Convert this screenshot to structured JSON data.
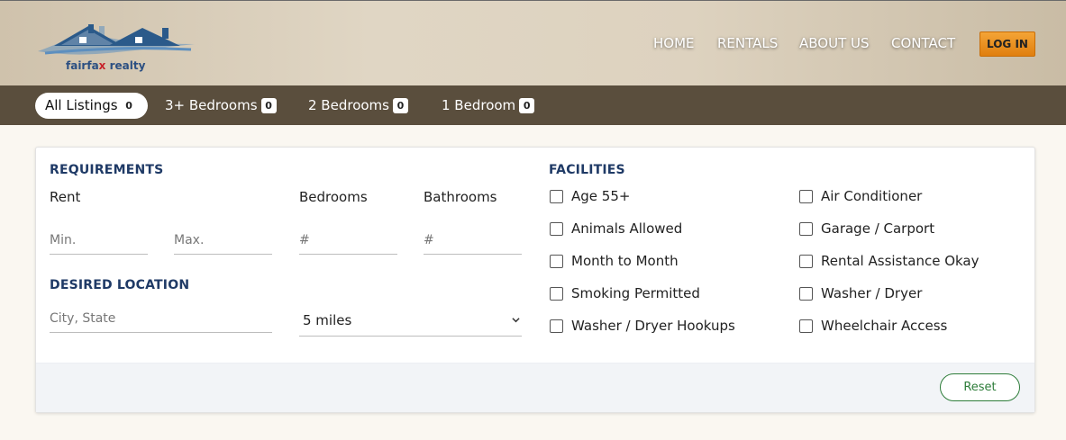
{
  "brand": {
    "name_part1": "fairfa",
    "name_x": "x",
    "name_part2": " realty",
    "colors": {
      "roof_blue": "#2b5a8a",
      "roof_light": "#5d8fbf",
      "accent_red": "#c8242b"
    }
  },
  "nav": {
    "items": [
      {
        "label": "HOME"
      },
      {
        "label": "RENTALS"
      },
      {
        "label": "ABOUT US"
      },
      {
        "label": "CONTACT"
      }
    ],
    "login_label": "LOG IN",
    "login_color": "#ee8f1d"
  },
  "tabs": [
    {
      "label": "All Listings",
      "count": "0",
      "active": true
    },
    {
      "label": "3+ Bedrooms",
      "count": "0",
      "active": false
    },
    {
      "label": "2 Bedrooms",
      "count": "0",
      "active": false
    },
    {
      "label": "1 Bedroom",
      "count": "0",
      "active": false
    }
  ],
  "requirements": {
    "title": "REQUIREMENTS",
    "rent_label": "Rent",
    "rent_min_placeholder": "Min.",
    "rent_max_placeholder": "Max.",
    "bedrooms_label": "Bedrooms",
    "bedrooms_placeholder": "#",
    "bathrooms_label": "Bathrooms",
    "bathrooms_placeholder": "#"
  },
  "location": {
    "title": "DESIRED LOCATION",
    "city_placeholder": "City, State",
    "radius_selected": "5 miles"
  },
  "facilities": {
    "title": "FACILITIES",
    "left": [
      "Age 55+",
      "Animals Allowed",
      "Month to Month",
      "Smoking Permitted",
      "Washer / Dryer Hookups"
    ],
    "right": [
      "Air Conditioner",
      "Garage / Carport",
      "Rental Assistance Okay",
      "Washer / Dryer",
      "Wheelchair Access"
    ]
  },
  "footer": {
    "reset_label": "Reset"
  }
}
